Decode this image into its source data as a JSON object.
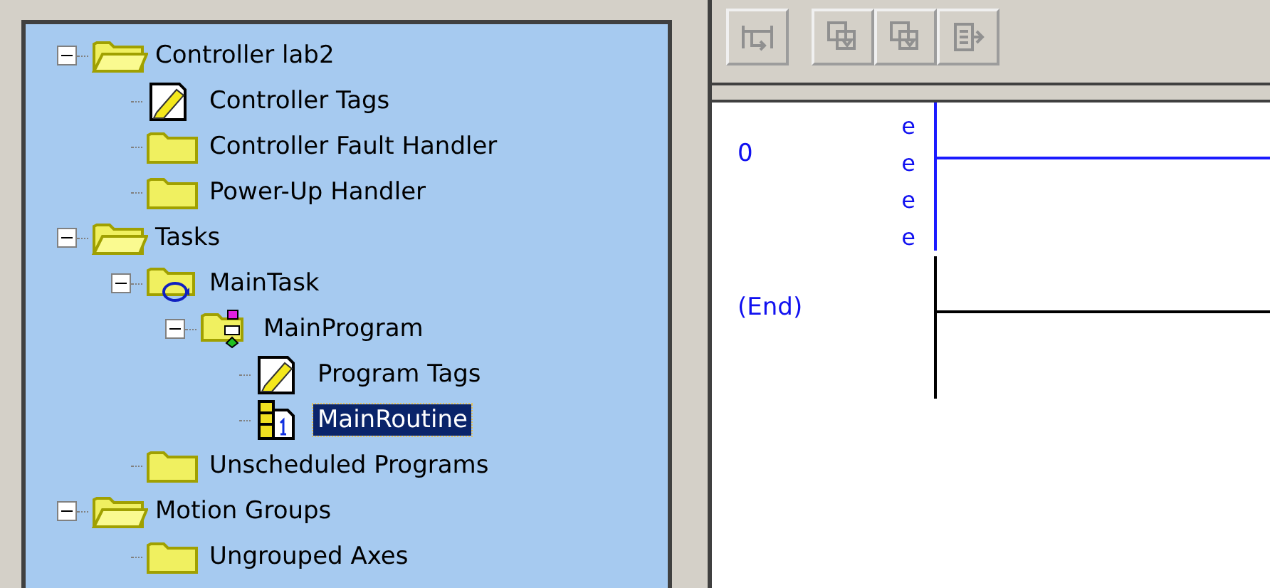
{
  "tree": [
    {
      "label": "Controller lab2",
      "kind": "folder-open",
      "expanded": true,
      "selected": false,
      "children": [
        {
          "label": "Controller Tags",
          "kind": "tags",
          "selected": false
        },
        {
          "label": "Controller Fault Handler",
          "kind": "folder",
          "selected": false
        },
        {
          "label": "Power-Up Handler",
          "kind": "folder",
          "selected": false
        }
      ]
    },
    {
      "label": "Tasks",
      "kind": "folder-open",
      "expanded": true,
      "selected": false,
      "children": [
        {
          "label": "MainTask",
          "kind": "task",
          "expanded": true,
          "selected": false,
          "children": [
            {
              "label": "MainProgram",
              "kind": "program",
              "expanded": true,
              "selected": false,
              "children": [
                {
                  "label": "Program Tags",
                  "kind": "tags",
                  "selected": false
                },
                {
                  "label": "MainRoutine",
                  "kind": "routine",
                  "selected": true
                }
              ]
            }
          ]
        },
        {
          "label": "Unscheduled Programs",
          "kind": "folder",
          "selected": false
        }
      ]
    },
    {
      "label": "Motion Groups",
      "kind": "folder-open",
      "expanded": true,
      "selected": false,
      "children": [
        {
          "label": "Ungrouped Axes",
          "kind": "folder",
          "selected": false
        }
      ]
    }
  ],
  "rungs": [
    {
      "kind": "rung",
      "number": "0",
      "marks": [
        "e",
        "e",
        "e",
        "e"
      ]
    },
    {
      "kind": "end",
      "number": "(End)"
    }
  ]
}
